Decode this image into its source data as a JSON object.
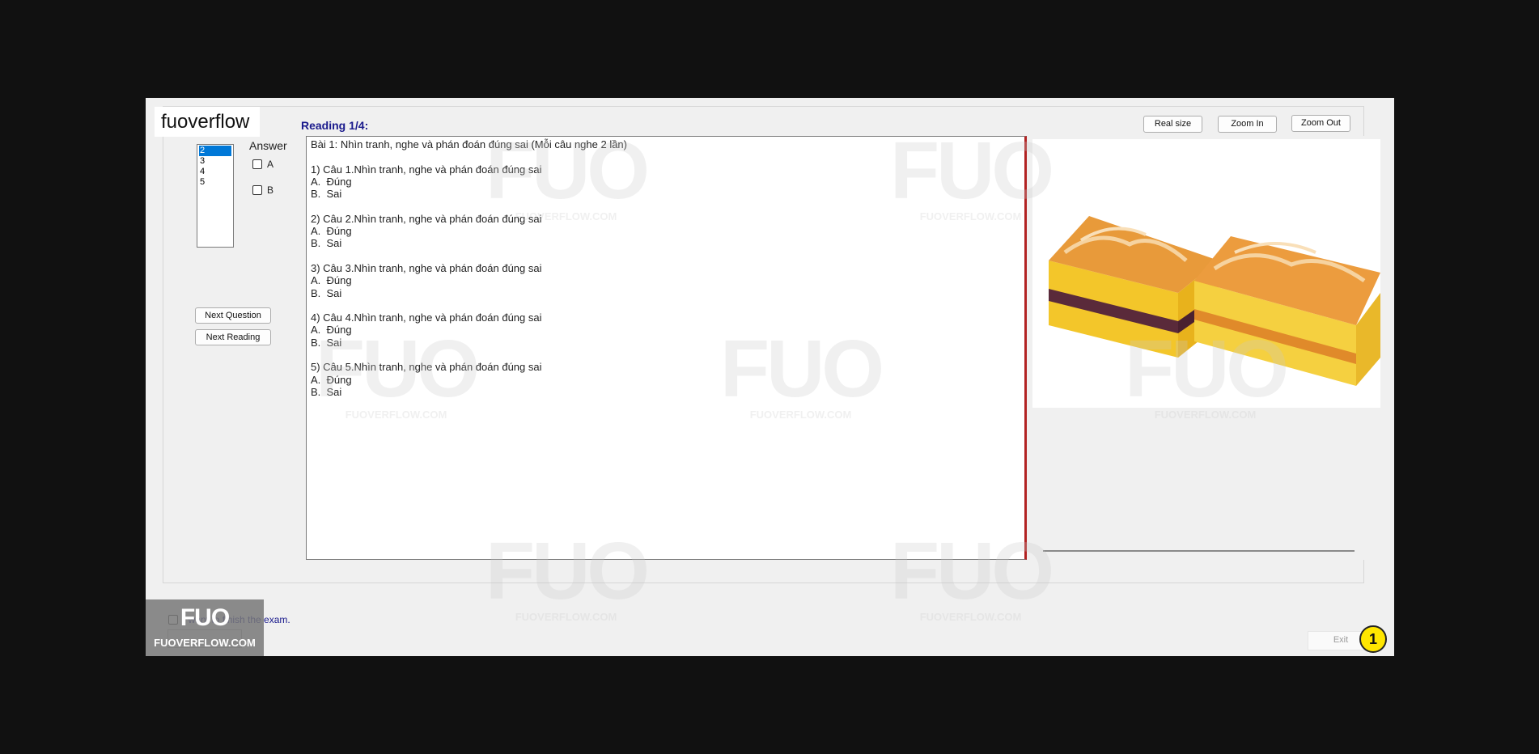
{
  "brand_text": "fuoverflow",
  "left_panel": {
    "answer_label": "Answer",
    "questions": [
      "2",
      "3",
      "4",
      "5"
    ],
    "selected_question": "2",
    "options": [
      "A",
      "B"
    ],
    "next_question_label": "Next Question",
    "next_reading_label": "Next Reading"
  },
  "reading": {
    "title": "Reading 1/4:",
    "lines": [
      "Bài 1: Nhìn tranh, nghe và phán đoán đúng sai (Mỗi câu nghe 2 lần)",
      "",
      "1) Câu 1.Nhìn tranh, nghe và phán đoán đúng sai",
      "A.  Đúng",
      "B.  Sai",
      "",
      "2) Câu 2.Nhìn tranh, nghe và phán đoán đúng sai",
      "A.  Đúng",
      "B.  Sai",
      "",
      "3) Câu 3.Nhìn tranh, nghe và phán đoán đúng sai",
      "A.  Đúng",
      "B.  Sai",
      "",
      "4) Câu 4.Nhìn tranh, nghe và phán đoán đúng sai",
      "A.  Đúng",
      "B.  Sai",
      "",
      "5) Câu 5.Nhìn tranh, nghe và phán đoán đúng sai",
      "A.  Đúng",
      "B.  Sai"
    ]
  },
  "image_controls": {
    "real_size_label": "Real size",
    "zoom_in_label": "Zoom In",
    "zoom_out_label": "Zoom Out"
  },
  "footer": {
    "finish_text": "I want to finish the exam.",
    "exit_label": "Exit",
    "marker_number": "1"
  },
  "watermark": {
    "logo": "FUO",
    "site": "FUOVERFLOW.COM"
  }
}
